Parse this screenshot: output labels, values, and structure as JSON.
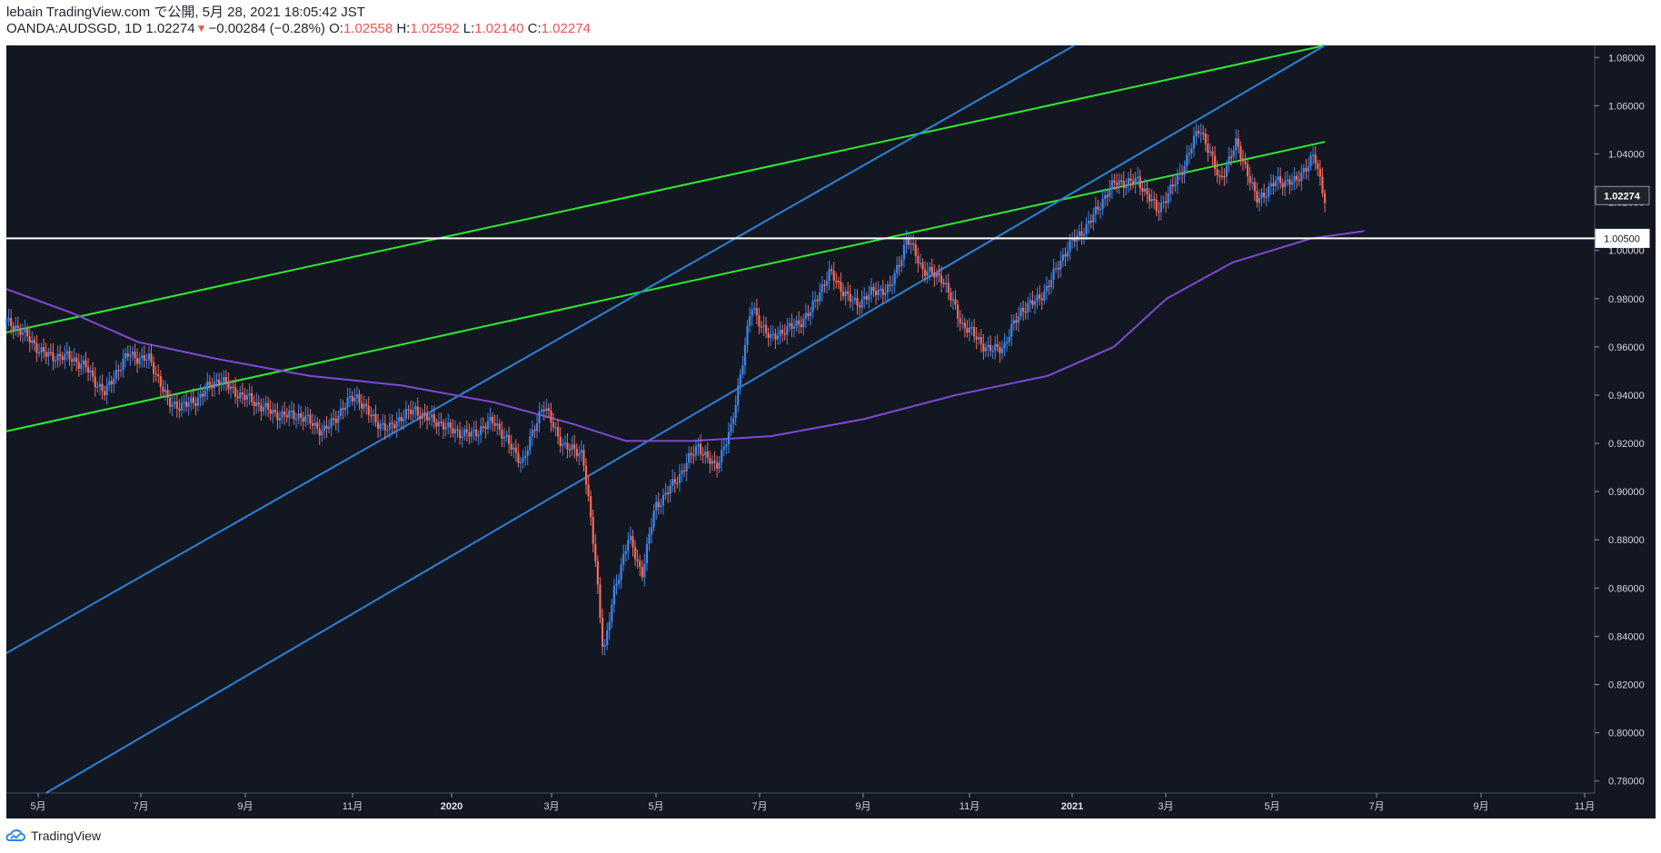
{
  "header": {
    "publisher_line": "lebain TradingView.com で公開, 5月 28, 2021 18:05:42 JST",
    "symbol_prefix": "OANDA:AUDSGD, 1D 1.02274",
    "change_text": "−0.00284 (−0.28%)",
    "open_label": "O:",
    "open_value": "1.02558",
    "high_label": "H:",
    "high_value": "1.02592",
    "low_label": "L:",
    "low_value": "1.02140",
    "close_label": "C:",
    "close_value": "1.02274"
  },
  "branding": {
    "label": "TradingView"
  },
  "chart_data": {
    "type": "candlestick",
    "symbol": "OANDA:AUDSGD",
    "interval": "1D",
    "y_axis_range": [
      0.775,
      1.085
    ],
    "x_axis_ticks": [
      "5月",
      "7月",
      "9月",
      "11月",
      "2020",
      "3月",
      "5月",
      "7月",
      "9月",
      "11月",
      "2021",
      "3月",
      "5月",
      "7月",
      "9月",
      "11月"
    ],
    "y_axis_ticks": [
      "1.08000",
      "1.06000",
      "1.04000",
      "1.02000",
      "1.00000",
      "0.98000",
      "0.96000",
      "0.94000",
      "0.92000",
      "0.90000",
      "0.88000",
      "0.86000",
      "0.84000",
      "0.82000",
      "0.80000",
      "0.78000"
    ],
    "current_price_label": "1.02274",
    "horizontal_level_label": "1.00500",
    "horizontal_level": 1.005,
    "price_path": [
      {
        "t": 0.0,
        "v": 0.97
      },
      {
        "t": 0.035,
        "v": 0.956
      },
      {
        "t": 0.06,
        "v": 0.953
      },
      {
        "t": 0.075,
        "v": 0.94
      },
      {
        "t": 0.093,
        "v": 0.958
      },
      {
        "t": 0.108,
        "v": 0.955
      },
      {
        "t": 0.123,
        "v": 0.936
      },
      {
        "t": 0.145,
        "v": 0.938
      },
      {
        "t": 0.163,
        "v": 0.947
      },
      {
        "t": 0.19,
        "v": 0.935
      },
      {
        "t": 0.215,
        "v": 0.932
      },
      {
        "t": 0.24,
        "v": 0.926
      },
      {
        "t": 0.265,
        "v": 0.939
      },
      {
        "t": 0.29,
        "v": 0.925
      },
      {
        "t": 0.31,
        "v": 0.935
      },
      {
        "t": 0.335,
        "v": 0.925
      },
      {
        "t": 0.355,
        "v": 0.925
      },
      {
        "t": 0.37,
        "v": 0.928
      },
      {
        "t": 0.392,
        "v": 0.913
      },
      {
        "t": 0.407,
        "v": 0.935
      },
      {
        "t": 0.423,
        "v": 0.92
      },
      {
        "t": 0.437,
        "v": 0.915
      },
      {
        "t": 0.447,
        "v": 0.87
      },
      {
        "t": 0.453,
        "v": 0.833
      },
      {
        "t": 0.461,
        "v": 0.86
      },
      {
        "t": 0.472,
        "v": 0.88
      },
      {
        "t": 0.482,
        "v": 0.865
      },
      {
        "t": 0.492,
        "v": 0.895
      },
      {
        "t": 0.51,
        "v": 0.905
      },
      {
        "t": 0.525,
        "v": 0.92
      },
      {
        "t": 0.538,
        "v": 0.91
      },
      {
        "t": 0.55,
        "v": 0.925
      },
      {
        "t": 0.565,
        "v": 0.978
      },
      {
        "t": 0.58,
        "v": 0.962
      },
      {
        "t": 0.61,
        "v": 0.975
      },
      {
        "t": 0.625,
        "v": 0.99
      },
      {
        "t": 0.645,
        "v": 0.978
      },
      {
        "t": 0.67,
        "v": 0.985
      },
      {
        "t": 0.683,
        "v": 1.005
      },
      {
        "t": 0.695,
        "v": 0.991
      },
      {
        "t": 0.71,
        "v": 0.99
      },
      {
        "t": 0.725,
        "v": 0.968
      },
      {
        "t": 0.745,
        "v": 0.96
      },
      {
        "t": 0.757,
        "v": 0.96
      },
      {
        "t": 0.77,
        "v": 0.975
      },
      {
        "t": 0.79,
        "v": 0.985
      },
      {
        "t": 0.81,
        "v": 1.005
      },
      {
        "t": 0.825,
        "v": 1.015
      },
      {
        "t": 0.842,
        "v": 1.028
      },
      {
        "t": 0.858,
        "v": 1.03
      },
      {
        "t": 0.873,
        "v": 1.015
      },
      {
        "t": 0.892,
        "v": 1.035
      },
      {
        "t": 0.905,
        "v": 1.05
      },
      {
        "t": 0.92,
        "v": 1.03
      },
      {
        "t": 0.933,
        "v": 1.045
      },
      {
        "t": 0.948,
        "v": 1.02
      },
      {
        "t": 0.963,
        "v": 1.03
      },
      {
        "t": 0.978,
        "v": 1.027
      },
      {
        "t": 0.992,
        "v": 1.04
      },
      {
        "t": 1.0,
        "v": 1.02274
      }
    ],
    "moving_average": [
      {
        "t": 0.0,
        "v": 0.984
      },
      {
        "t": 0.05,
        "v": 0.974
      },
      {
        "t": 0.1,
        "v": 0.962
      },
      {
        "t": 0.16,
        "v": 0.955
      },
      {
        "t": 0.23,
        "v": 0.948
      },
      {
        "t": 0.3,
        "v": 0.944
      },
      {
        "t": 0.37,
        "v": 0.937
      },
      {
        "t": 0.43,
        "v": 0.928
      },
      {
        "t": 0.47,
        "v": 0.921
      },
      {
        "t": 0.52,
        "v": 0.921
      },
      {
        "t": 0.58,
        "v": 0.923
      },
      {
        "t": 0.65,
        "v": 0.93
      },
      {
        "t": 0.72,
        "v": 0.94
      },
      {
        "t": 0.79,
        "v": 0.948
      },
      {
        "t": 0.84,
        "v": 0.96
      },
      {
        "t": 0.88,
        "v": 0.98
      },
      {
        "t": 0.93,
        "v": 0.995
      },
      {
        "t": 0.99,
        "v": 1.005
      },
      {
        "t": 1.03,
        "v": 1.008
      }
    ],
    "trend_lines": [
      {
        "color": "#2eea2e",
        "start": [
          0.0,
          0.966
        ],
        "end": [
          1.0,
          1.085
        ]
      },
      {
        "color": "#2eea2e",
        "start": [
          0.0,
          0.925
        ],
        "end": [
          1.0,
          1.045
        ]
      },
      {
        "color": "#2a82d8",
        "start": [
          0.0,
          0.833
        ],
        "end": [
          0.81,
          1.085
        ]
      },
      {
        "color": "#2a82d8",
        "start": [
          0.03,
          0.775
        ],
        "end": [
          1.0,
          1.085
        ]
      }
    ],
    "up_color": "#3d86ea",
    "down_color": "#f26a5b",
    "ma_color": "#7f49d4",
    "level_color": "#ffffff",
    "grid": false,
    "legend": "top-left"
  }
}
